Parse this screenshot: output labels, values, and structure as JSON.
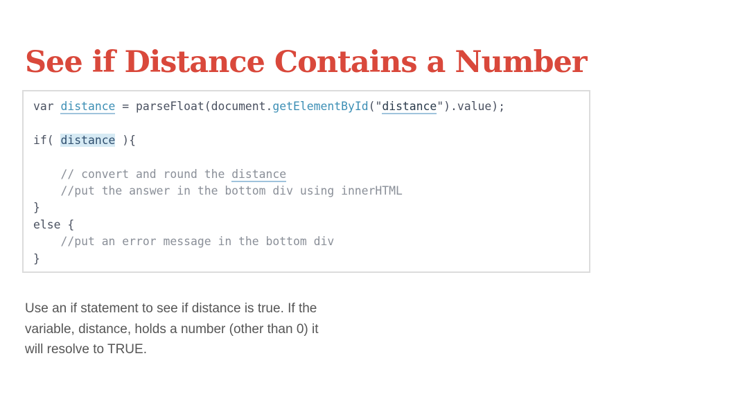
{
  "slide": {
    "title": "See if Distance Contains a Number",
    "description": "Use an if statement to see if distance is true. If the variable, distance, holds a number (other than 0) it will resolve to TRUE."
  },
  "code": {
    "line1": {
      "kw_var": "var",
      "space1": " ",
      "ident": "distance",
      "assign": " = ",
      "parse": "parseFloat(document.",
      "method": "getElementById",
      "open": "(\"",
      "str": "distance",
      "close": "\").value);"
    },
    "line3": {
      "kw_if": "if(",
      "space": " ",
      "ident": "distance",
      "rest": " ){"
    },
    "line5": {
      "indent": "    ",
      "comment_pre": "// convert and round the ",
      "comment_word": "distance"
    },
    "line6": {
      "indent": "    ",
      "comment": "//put the answer in the bottom div using innerHTML"
    },
    "line7": {
      "brace": "}"
    },
    "line8": {
      "kw_else": "else {"
    },
    "line9": {
      "indent": "    ",
      "comment": "//put an error message in the bottom div"
    },
    "line10": {
      "brace": "}"
    }
  },
  "colors": {
    "title": "#d9483b",
    "identifier": "#3d8fb5",
    "highlight": "#d6eaf4",
    "comment": "#8a8f98",
    "body_text": "#555555"
  }
}
